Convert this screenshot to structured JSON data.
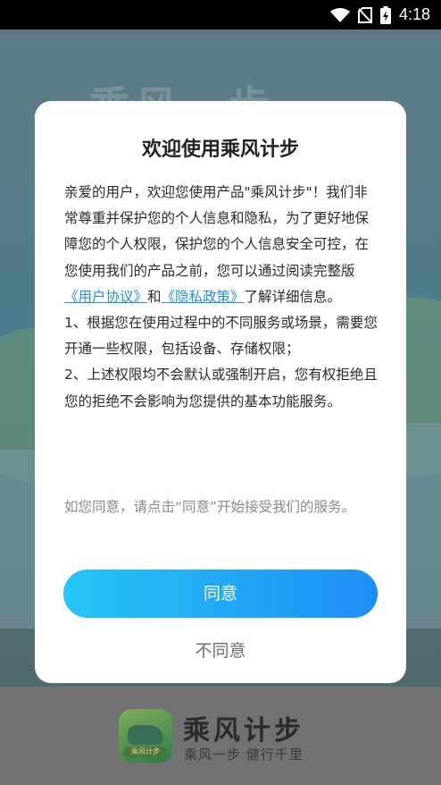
{
  "status_bar": {
    "time": "4:18"
  },
  "background": {
    "ghost_title": "乘风一步"
  },
  "dialog": {
    "title": "欢迎使用乘风计步",
    "paragraph_intro_a": "亲爱的用户，欢迎您使用产品\"乘风计步\"！我们非常尊重并保护您的个人信息和隐私，为了更好地保障您的个人权限，保护您的个人信息安全可控，在您使用我们的产品之前，您可以通过阅读完整版",
    "user_agreement_link": "《用户协议》",
    "conj": "和",
    "privacy_policy_link": "《隐私政策》",
    "paragraph_intro_b": "了解详细信息。",
    "item_1": "1、根据您在使用过程中的不同服务或场景，需要您开通一些权限，包括设备、存储权限；",
    "item_2": "2、上述权限均不会默认或强制开启，您有权拒绝且您的拒绝不会影响为您提供的基本功能服务。",
    "hint": "如您同意，请点击“同意”开始接受我们的服务。",
    "agree_label": "同意",
    "disagree_label": "不同意"
  },
  "footer": {
    "logo_tag": "乘风计步",
    "brand_name": "乘风计步",
    "slogan": "乘风一步  健行千里"
  },
  "colors": {
    "accent_start": "#27c4f5",
    "accent_end": "#1f8ef5",
    "link": "#2a8fdc"
  }
}
